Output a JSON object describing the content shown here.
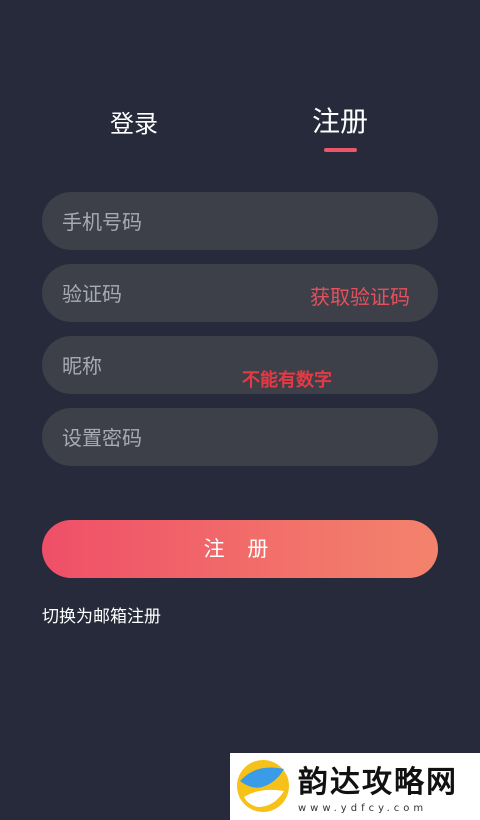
{
  "tabs": {
    "login": "登录",
    "register": "注册",
    "active": "register"
  },
  "form": {
    "phone": {
      "placeholder": "手机号码",
      "value": ""
    },
    "code": {
      "placeholder": "验证码",
      "value": "",
      "get_code_label": "获取验证码"
    },
    "nickname": {
      "placeholder": "昵称",
      "value": ""
    },
    "password": {
      "placeholder": "设置密码",
      "value": ""
    }
  },
  "annotation": "不能有数字",
  "submit_label": "注 册",
  "switch_label": "切换为邮箱注册",
  "watermark": {
    "title": "韵达攻略网",
    "url": "www.ydfcy.com"
  },
  "colors": {
    "background": "#262a3a",
    "field": "#3d4049",
    "accent": "#e9586a",
    "gradient_start": "#ef4f68",
    "gradient_end": "#f3836c"
  }
}
